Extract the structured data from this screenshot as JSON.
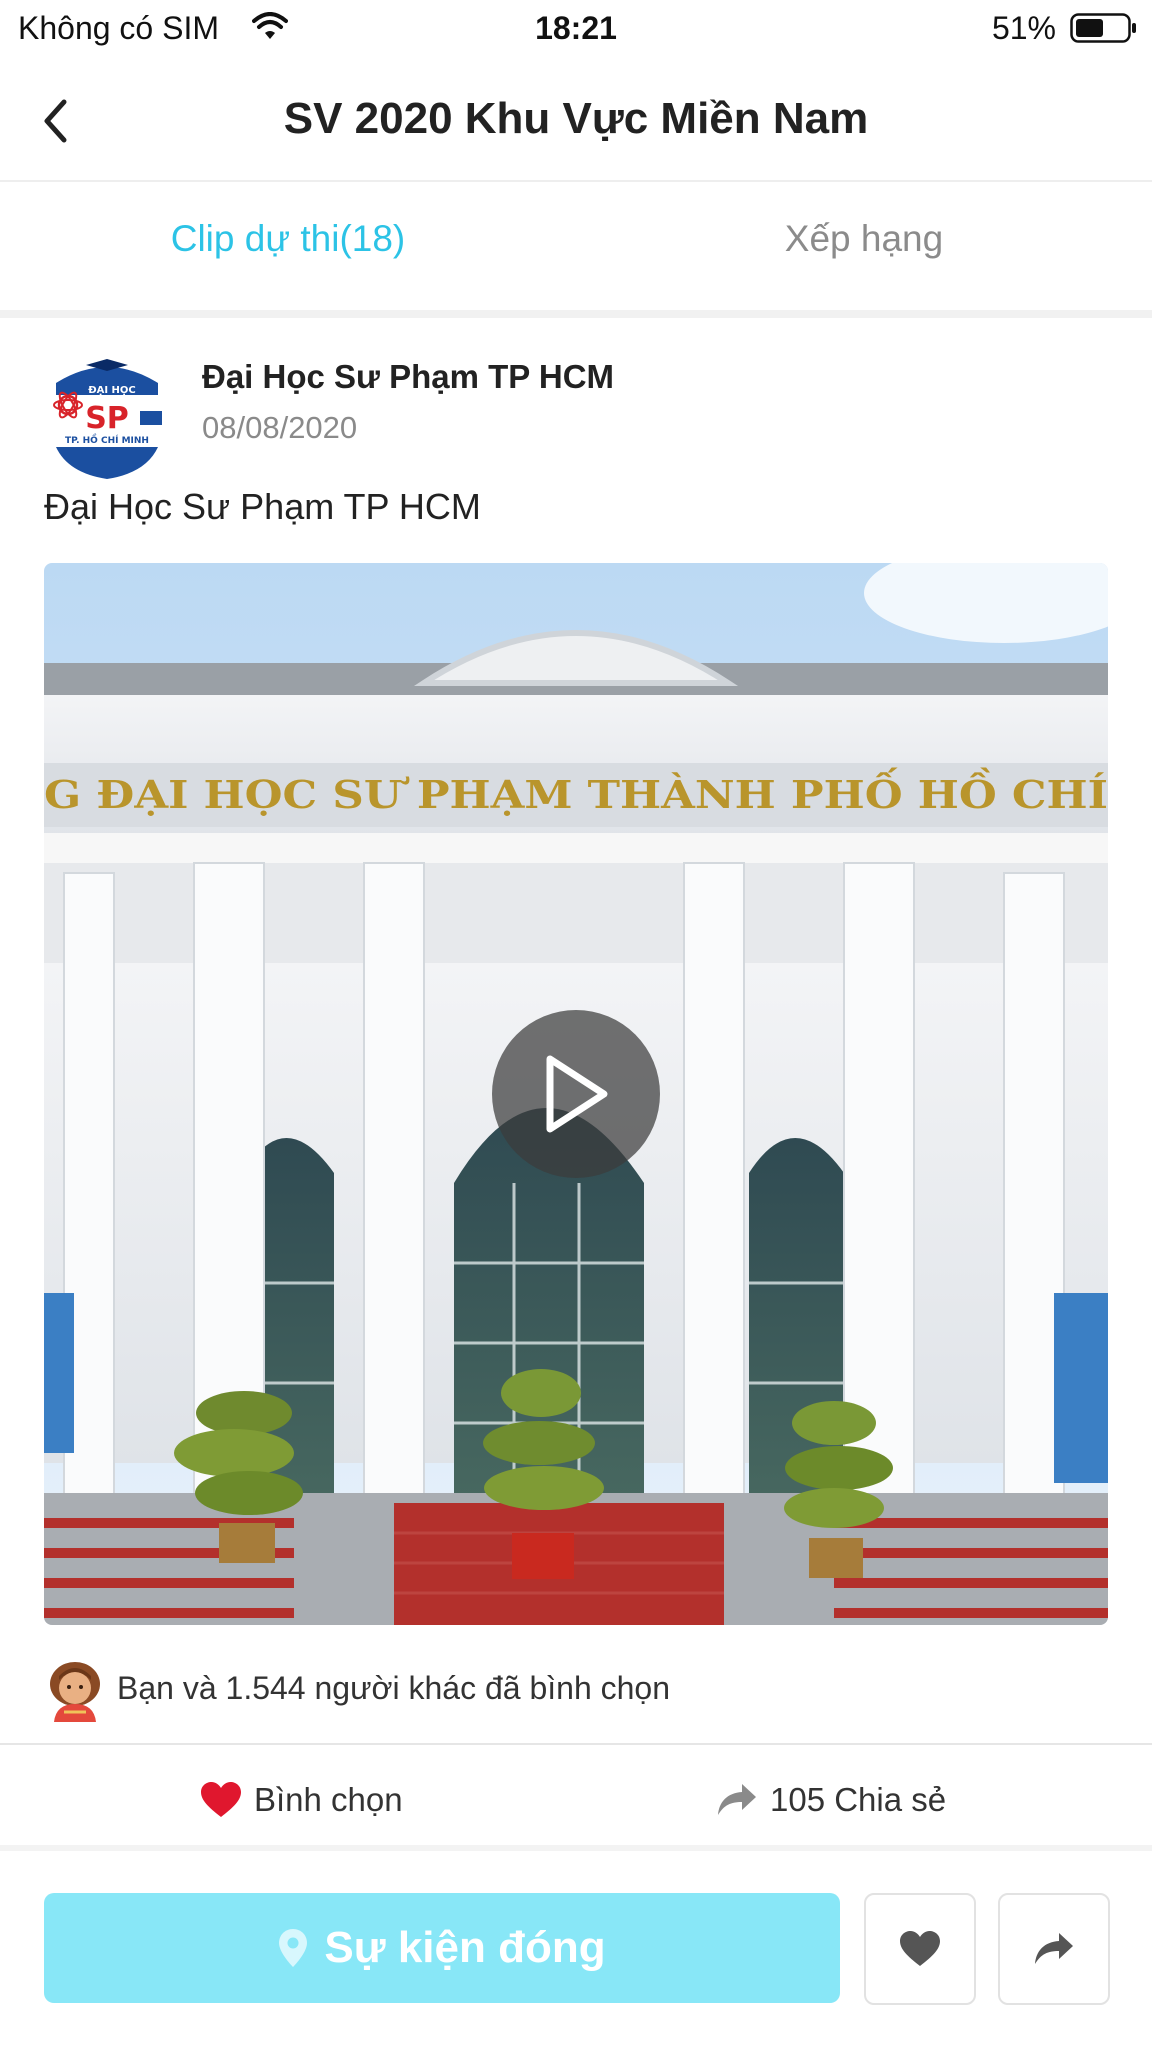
{
  "status_bar": {
    "carrier": "Không có SIM",
    "time": "18:21",
    "battery": "51%",
    "battery_level": 0.51
  },
  "header": {
    "title": "SV 2020 Khu Vực Miền Nam",
    "back_icon": "chevron-left-icon"
  },
  "tabs": [
    {
      "label": "Clip dự thi(18)",
      "active": true
    },
    {
      "label": "Xếp hạng",
      "active": false
    }
  ],
  "post": {
    "author": "Đại Học Sư Phạm TP HCM",
    "date": "08/08/2020",
    "caption": "Đại Học Sư Phạm TP HCM",
    "logo": {
      "line1": "ĐẠI HỌC",
      "line2": "SP",
      "line3": "TP. HỒ CHÍ MINH"
    },
    "video_sign": "G ĐẠI HỌC SƯ PHẠM THÀNH PHỐ HỒ CHÍ",
    "votes_text": "Bạn và 1.544 người khác đã bình chọn"
  },
  "actions": {
    "vote_label": "Bình chọn",
    "share_label": "105 Chia sẻ"
  },
  "bottom_bar": {
    "event_label": "Sự kiện đóng"
  },
  "colors": {
    "accent": "#2cc3e6",
    "event_button": "#88e7f7",
    "heart": "#e0172e",
    "muted": "#8b8b8b"
  }
}
